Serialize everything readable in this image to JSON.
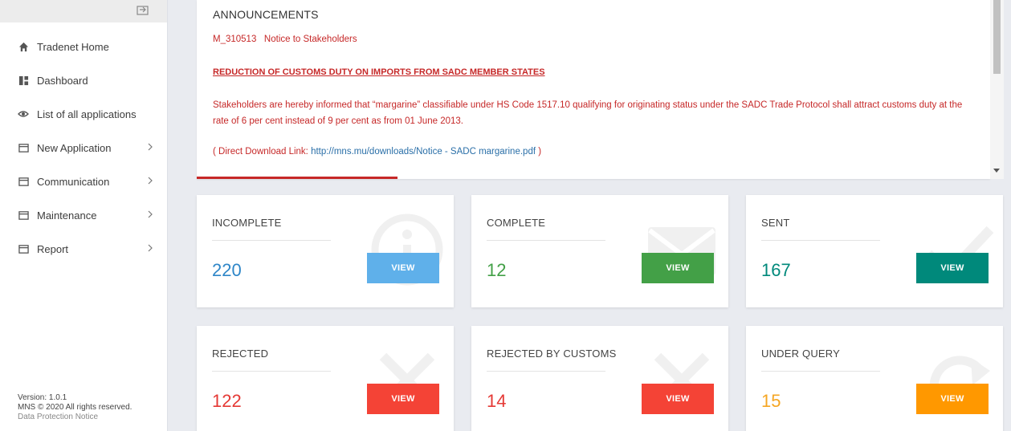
{
  "sidebar": {
    "items": [
      {
        "label": "Tradenet Home",
        "icon": "home-icon"
      },
      {
        "label": "Dashboard",
        "icon": "dashboard-icon"
      },
      {
        "label": "List of all applications",
        "icon": "eye-icon"
      },
      {
        "label": "New Application",
        "icon": "window-icon",
        "submenu": true
      },
      {
        "label": "Communication",
        "icon": "window-icon",
        "submenu": true
      },
      {
        "label": "Maintenance",
        "icon": "window-icon",
        "submenu": true
      },
      {
        "label": "Report",
        "icon": "window-icon",
        "submenu": true
      }
    ],
    "footer": {
      "version": "Version: 1.0.1",
      "copyright": "MNS © 2020 All rights reserved.",
      "privacy": "Data Protection Notice"
    }
  },
  "announcements": {
    "title": "ANNOUNCEMENTS",
    "notice_id": "M_310513   Notice to Stakeholders",
    "heading": "REDUCTION OF CUSTOMS DUTY ON IMPORTS FROM SADC MEMBER STATES",
    "body": "Stakeholders are hereby informed that “margarine” classifiable under HS Code 1517.10 qualifying for originating status under the SADC Trade Protocol shall attract customs duty at the rate of 6 per cent instead of 9 per cent as from 01 June 2013.",
    "link_prefix": "( Direct Download Link: ",
    "link_text": "http://mns.mu/downloads/Notice - SADC margarine.pdf",
    "link_suffix": " )"
  },
  "cards": [
    {
      "title": "INCOMPLETE",
      "count": "220",
      "button": "VIEW",
      "color": "#2e86c8",
      "button_color": "#5fb0ea",
      "icon": "info-icon"
    },
    {
      "title": "COMPLETE",
      "count": "12",
      "button": "VIEW",
      "color": "#43a047",
      "button_color": "#43a047",
      "icon": "envelope-icon"
    },
    {
      "title": "SENT",
      "count": "167",
      "button": "VIEW",
      "color": "#00897b",
      "button_color": "#00897b",
      "icon": "check-icon"
    },
    {
      "title": "REJECTED",
      "count": "122",
      "button": "VIEW",
      "color": "#e53935",
      "button_color": "#f44336",
      "icon": "x-icon"
    },
    {
      "title": "REJECTED BY CUSTOMS",
      "count": "14",
      "button": "VIEW",
      "color": "#e53935",
      "button_color": "#f44336",
      "icon": "x-icon"
    },
    {
      "title": "UNDER QUERY",
      "count": "15",
      "button": "VIEW",
      "color": "#f5a623",
      "button_color": "#ff9800",
      "icon": "refresh-icon"
    }
  ]
}
